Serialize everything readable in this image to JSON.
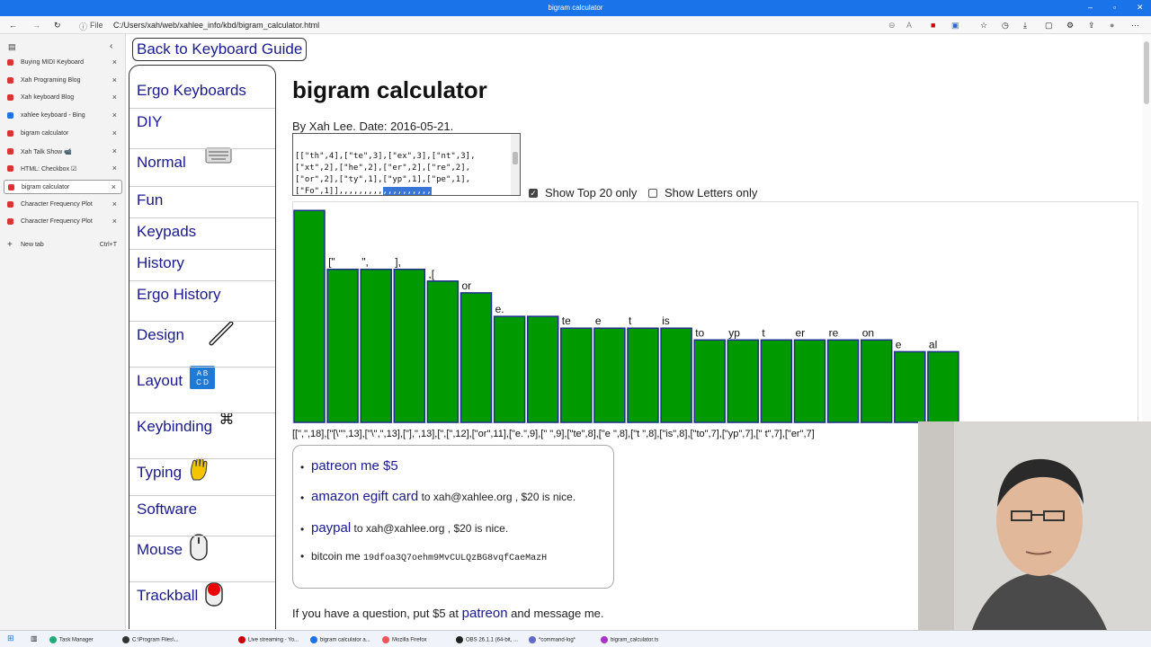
{
  "window": {
    "title": "bigram calculator"
  },
  "address": {
    "scheme": "File",
    "url": "C:/Users/xah/web/xahlee_info/kbd/bigram_calculator.html"
  },
  "tabs": [
    {
      "label": "Buying MIDI Keyboard",
      "color": "#d33"
    },
    {
      "label": "Xah Programing Blog",
      "color": "#d33"
    },
    {
      "label": "Xah keyboard Blog",
      "color": "#d33"
    },
    {
      "label": "xahlee keyboard - Bing",
      "color": "#1a73e8"
    },
    {
      "label": "bigram calculator",
      "color": "#d33"
    },
    {
      "label": "Xah Talk Show 📹",
      "color": "#d33"
    },
    {
      "label": "HTML: Checkbox ☑",
      "color": "#d33"
    },
    {
      "label": "bigram calculator",
      "color": "#d33",
      "active": true
    },
    {
      "label": "Character Frequency Plot",
      "color": "#d33"
    },
    {
      "label": "Character Frequency Plot",
      "color": "#d33"
    }
  ],
  "new_tab": {
    "label": "New tab",
    "shortcut": "Ctrl+T"
  },
  "back_link": "Back to Keyboard Guide",
  "nav": [
    {
      "label": "Ergo Keyboards",
      "icon": ""
    },
    {
      "label": "DIY",
      "icon": ""
    },
    {
      "label": "Normal",
      "icon": "keyboard-icon"
    },
    {
      "label": "Fun",
      "icon": ""
    },
    {
      "label": "Keypads",
      "icon": ""
    },
    {
      "label": "History",
      "icon": ""
    },
    {
      "label": "Ergo History",
      "icon": ""
    },
    {
      "label": "Design",
      "icon": "wrench-icon"
    },
    {
      "label": "Layout",
      "icon": "abcd-icon"
    },
    {
      "label": "Keybinding",
      "icon": "command-icon"
    },
    {
      "label": "Typing",
      "icon": "hand-icon"
    },
    {
      "label": "Software",
      "icon": ""
    },
    {
      "label": "Mouse",
      "icon": "mouse-icon"
    },
    {
      "label": "Trackball",
      "icon": "trackball-icon"
    }
  ],
  "page": {
    "title": "bigram calculator",
    "byline": "By Xah Lee. Date: 2016-05-21.",
    "textarea_lines": [
      "[[\"th\",4],[\"te\",3],[\"ex\",3],[\"nt\",3],",
      "[\"xt\",2],[\"he\",2],[\"er\",2],[\"re\",2],",
      "[\"or\",2],[\"ty\",1],[\"yp\",1],[\"pe\",1],",
      "[\"Fo\",1]],,,,,,,,,",
      "patreon me $5",
      "amazon egift card to xah@xahlee.org"
    ],
    "textarea_selected": ",,,,,,,,,,",
    "opt_top20": {
      "label": "Show Top 20 only",
      "checked": true
    },
    "opt_letters": {
      "label": "Show Letters only",
      "checked": false
    },
    "pairs_text": "[[\",\",18],[\"[\\\"\",13],[\"\\\",\",13],[\"],\",13],[\",[\",12],[\"or\",11],[\"e.\",9],[\" \",9],[\"te\",8],[\"e \",8],[\"t \",8],[\"is\",8],[\"to\",7],[\"yp\",7],[\" t\",7],[\"er\",7]"
  },
  "chart_data": {
    "type": "bar",
    "categories": [
      "",
      "[\"",
      "\",",
      "],",
      ",[",
      "or",
      "e.",
      "",
      "te",
      "e",
      "t",
      "is",
      "to",
      "yp",
      "t",
      "er",
      "re",
      "on",
      "e",
      "al"
    ],
    "values": [
      18,
      13,
      13,
      13,
      12,
      11,
      9,
      9,
      8,
      8,
      8,
      8,
      7,
      7,
      7,
      7,
      7,
      7,
      6,
      6
    ],
    "bar_color": "#009900",
    "edge_color": "#1f2f8f"
  },
  "donate": {
    "patreon": "patreon me $5",
    "amazon": "amazon egift card",
    "amazon_rest": "to xah@xahlee.org , $20 is nice.",
    "paypal": "paypal",
    "paypal_rest": "to xah@xahlee.org , $20 is nice.",
    "bitcoin": "bitcoin me",
    "bitcoin_addr": "19dfoa3Q7oehm9MvCULQzBG8vqfCaeMazH"
  },
  "question": {
    "prefix": "If you have a question, put $5 at",
    "link": "patreon",
    "suffix": "and message me."
  },
  "taskbar": [
    "Task Manager",
    "C:\\Program Files\\...",
    "Live streaming - Yo...",
    "bigram calculator a...",
    "Mozilla Firefox",
    "OBS 26.1.1 (64-bit, ...",
    "*command-log*",
    "bigram_calculator.ts"
  ]
}
